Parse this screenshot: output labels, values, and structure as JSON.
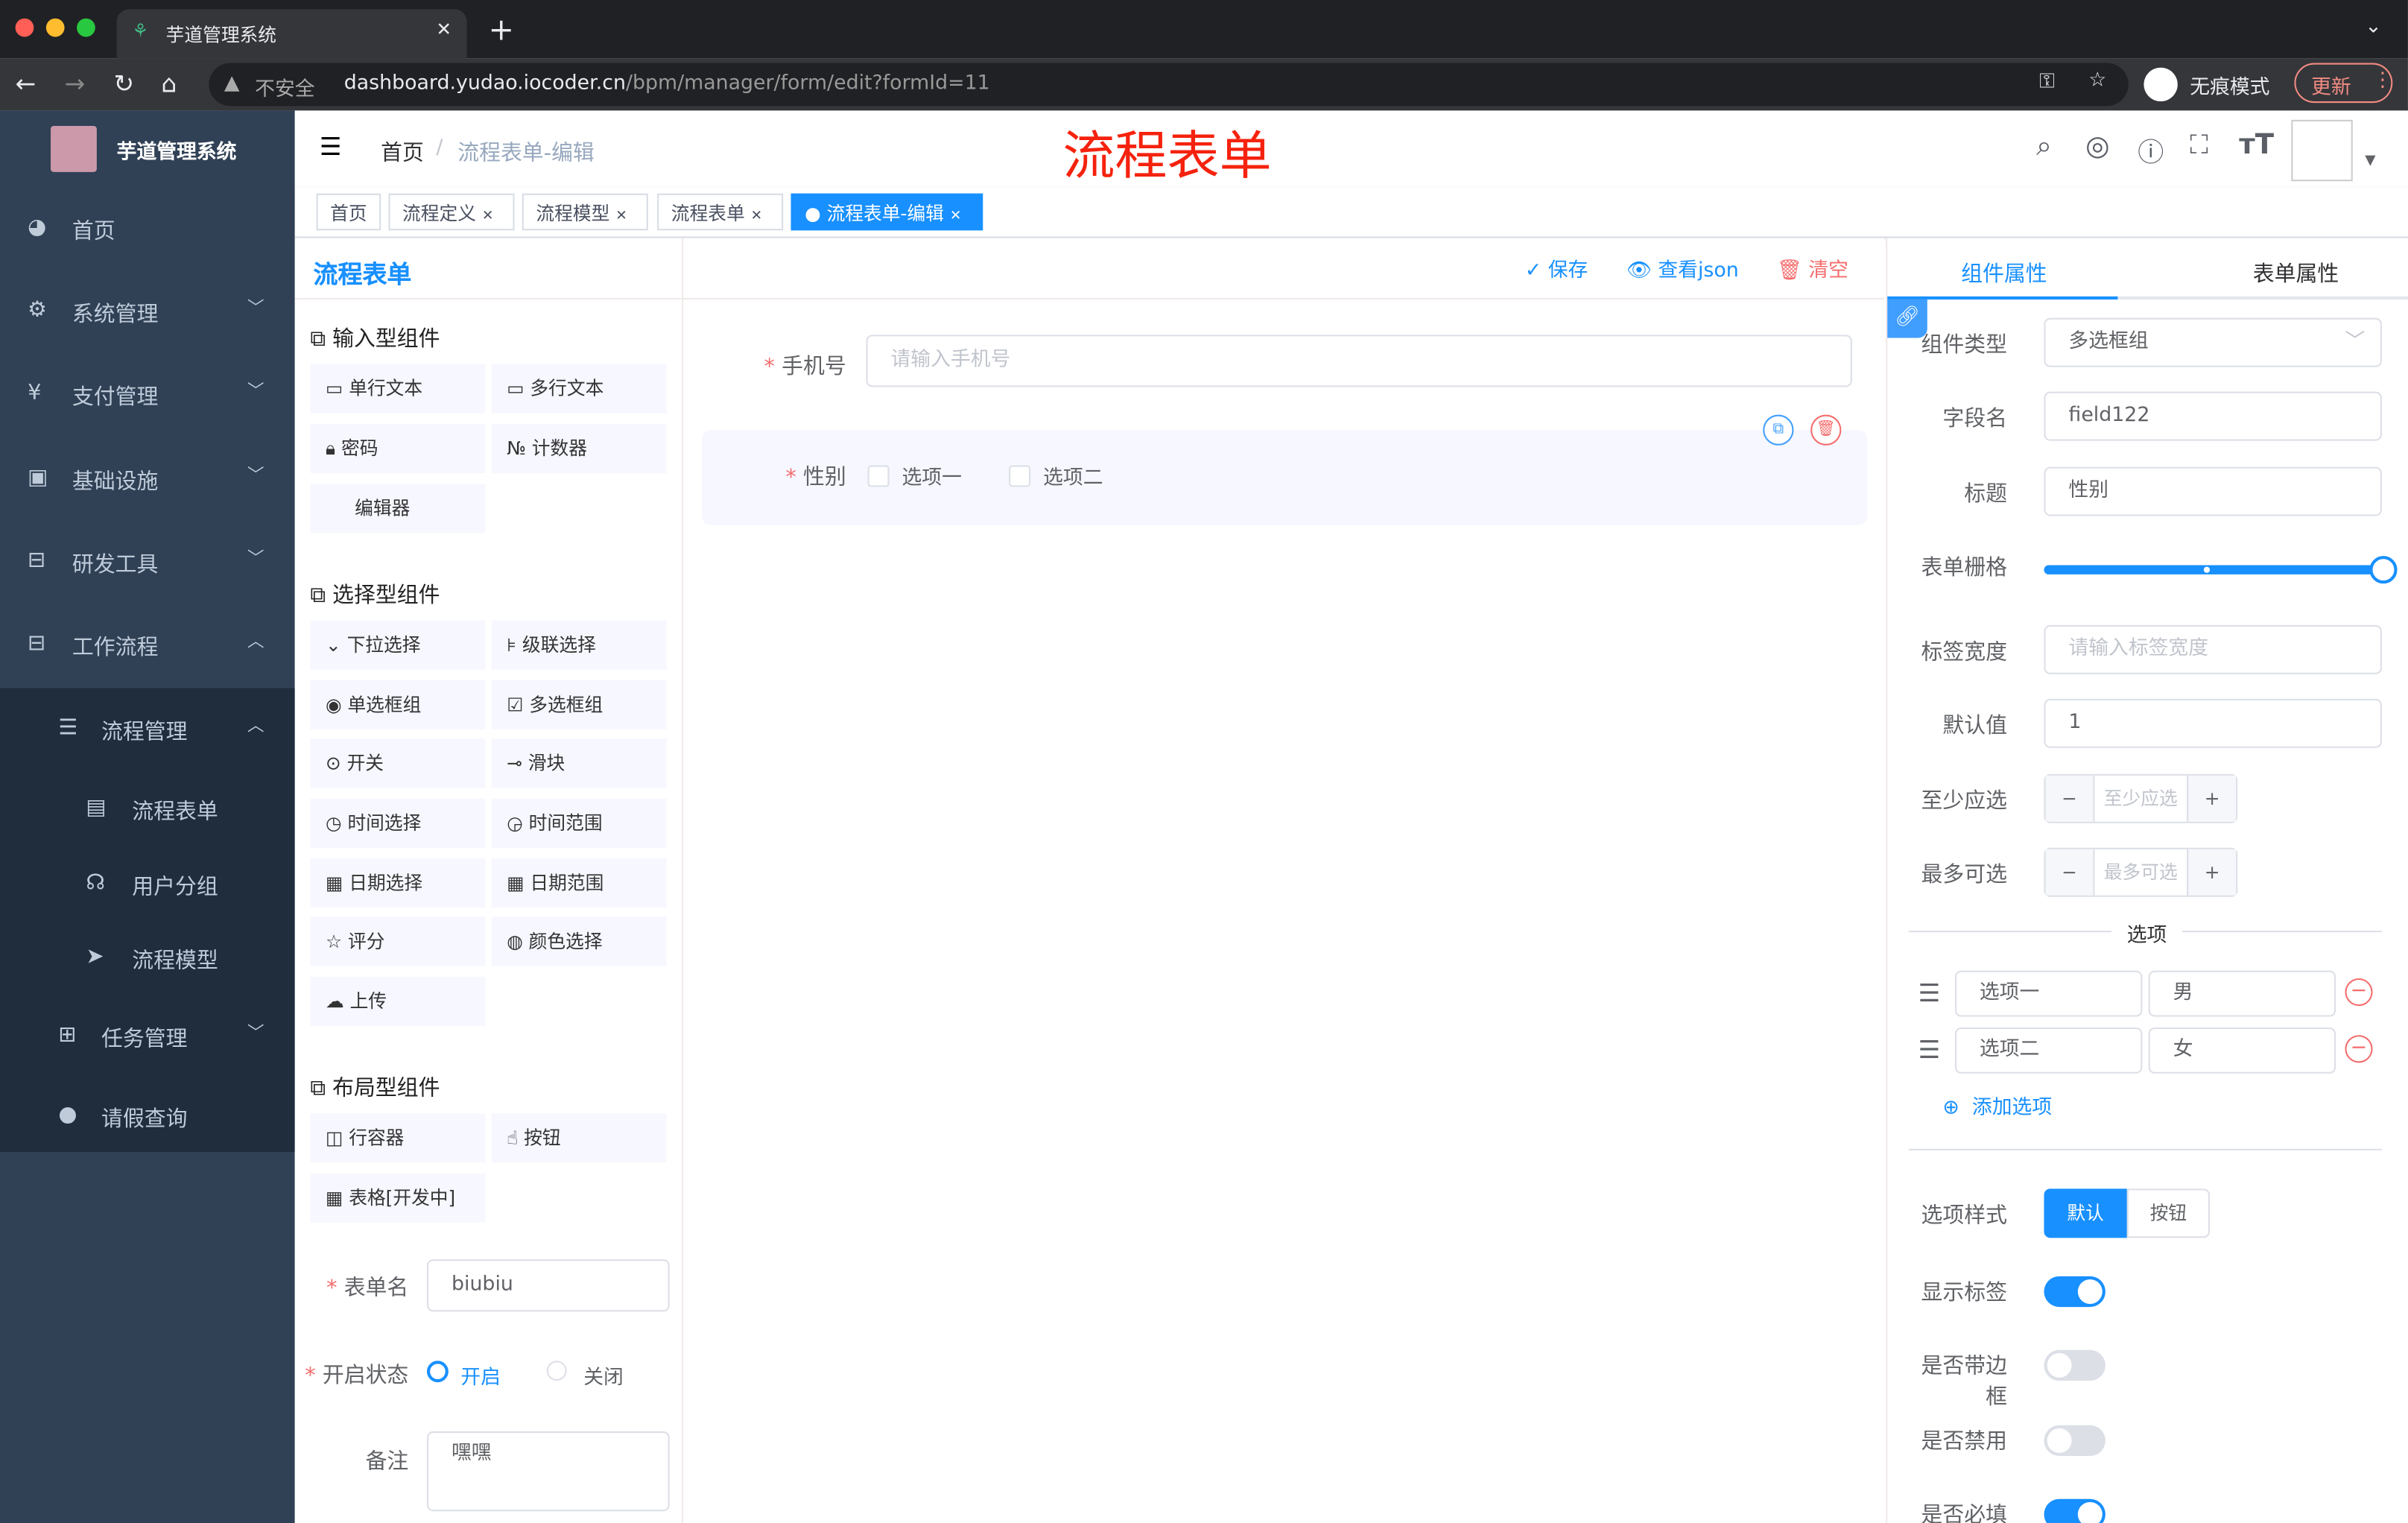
{
  "browser": {
    "tab_title": "芋道管理系统",
    "insecure": "不安全",
    "url_host": "dashboard.yudao.iocoder.cn",
    "url_path": "/bpm/manager/form/edit?formId=11",
    "incognito": "无痕模式",
    "update": "更新"
  },
  "sidebar": {
    "brand": "芋道管理系统",
    "items": [
      {
        "label": "首页",
        "icon": "dashboard-icon"
      },
      {
        "label": "系统管理",
        "icon": "gear-icon"
      },
      {
        "label": "支付管理",
        "icon": "yen-icon"
      },
      {
        "label": "基础设施",
        "icon": "monitor-icon"
      },
      {
        "label": "研发工具",
        "icon": "toolbox-icon"
      },
      {
        "label": "工作流程",
        "icon": "toolbox-icon"
      }
    ],
    "sub": [
      {
        "label": "流程管理"
      },
      {
        "label": "流程表单"
      },
      {
        "label": "用户分组"
      },
      {
        "label": "流程模型"
      },
      {
        "label": "任务管理"
      },
      {
        "label": "请假查询"
      }
    ]
  },
  "header": {
    "breadcrumb_home": "首页",
    "breadcrumb_current": "流程表单-编辑",
    "annotation": "流程表单"
  },
  "tags": [
    "首页",
    "流程定义",
    "流程模型",
    "流程表单",
    "流程表单-编辑"
  ],
  "builder": {
    "title": "流程表单",
    "save": "保存",
    "view_json": "查看json",
    "clear": "清空",
    "groups": [
      {
        "title": "输入型组件",
        "items": [
          "单行文本",
          "多行文本",
          "密码",
          "计数器",
          "编辑器"
        ]
      },
      {
        "title": "选择型组件",
        "items": [
          "下拉选择",
          "级联选择",
          "单选框组",
          "多选框组",
          "开关",
          "滑块",
          "时间选择",
          "时间范围",
          "日期选择",
          "日期范围",
          "评分",
          "颜色选择",
          "上传"
        ]
      },
      {
        "title": "布局型组件",
        "items": [
          "行容器",
          "按钮",
          "表格[开发中]"
        ]
      }
    ],
    "form_name_label": "表单名",
    "form_name": "biubiu",
    "status_label": "开启状态",
    "status_on": "开启",
    "status_off": "关闭",
    "remark_label": "备注",
    "remark": "嘿嘿"
  },
  "canvas": {
    "phone_label": "手机号",
    "phone_placeholder": "请输入手机号",
    "gender_label": "性别",
    "opt1": "选项一",
    "opt2": "选项二"
  },
  "props": {
    "tab_component": "组件属性",
    "tab_form": "表单属性",
    "type_label": "组件类型",
    "type_value": "多选框组",
    "field_label": "字段名",
    "field_value": "field122",
    "title_label": "标题",
    "title_value": "性别",
    "grid_label": "表单栅格",
    "grid_value": 24,
    "grid_max": 24,
    "label_width_label": "标签宽度",
    "label_width_placeholder": "请输入标签宽度",
    "default_label": "默认值",
    "default_value": "1",
    "min_label": "至少应选",
    "min_placeholder": "至少应选",
    "max_label": "最多可选",
    "max_placeholder": "最多可选",
    "options_title": "选项",
    "options": [
      {
        "label": "选项一",
        "value": "男"
      },
      {
        "label": "选项二",
        "value": "女"
      }
    ],
    "add_option": "添加选项",
    "style_label": "选项样式",
    "style_default": "默认",
    "style_button": "按钮",
    "show_label": "显示标签",
    "show_label_on": true,
    "border_label": "是否带边框",
    "border_on": false,
    "disabled_label": "是否禁用",
    "disabled_on": false,
    "required_label": "是否必填",
    "required_on": true
  }
}
